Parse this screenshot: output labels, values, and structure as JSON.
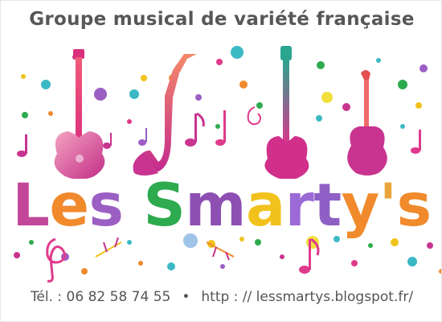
{
  "tagline": "Groupe musical de variété française",
  "title_letters": [
    {
      "char": "L",
      "color": "#c2479a"
    },
    {
      "char": "e",
      "color": "#f08a2c"
    },
    {
      "char": "s",
      "color": "#9b5fc4"
    },
    {
      "char": " ",
      "color": "#ffffff"
    },
    {
      "char": "S",
      "color": "#2eaa4f"
    },
    {
      "char": "m",
      "color": "#8e4fb3"
    },
    {
      "char": "a",
      "color": "#f2c21c"
    },
    {
      "char": "r",
      "color": "#9b6ad6"
    },
    {
      "char": "t",
      "color": "#8e5fc4"
    },
    {
      "char": "y",
      "color": "#f08a2c"
    },
    {
      "char": "'",
      "color": "#e8a53a"
    },
    {
      "char": "s",
      "color": "#f08a2c"
    }
  ],
  "contact": {
    "phone": "Tél. : 06 82 58 74 55",
    "separator": "•",
    "url": "http : // lessmartys.blogspot.fr/"
  },
  "colors": {
    "text_grey": "#575757",
    "pink": "#e03a8c",
    "magenta": "#c8348f",
    "purple": "#9b5fc4",
    "orange": "#f08a2c",
    "teal": "#3bb9c4",
    "green": "#2eaa4f",
    "yellow": "#f2e03c"
  },
  "icons": [
    "electric-guitar-icon",
    "saxophone-icon",
    "music-note-icon",
    "violin-icon",
    "treble-clef-icon"
  ]
}
